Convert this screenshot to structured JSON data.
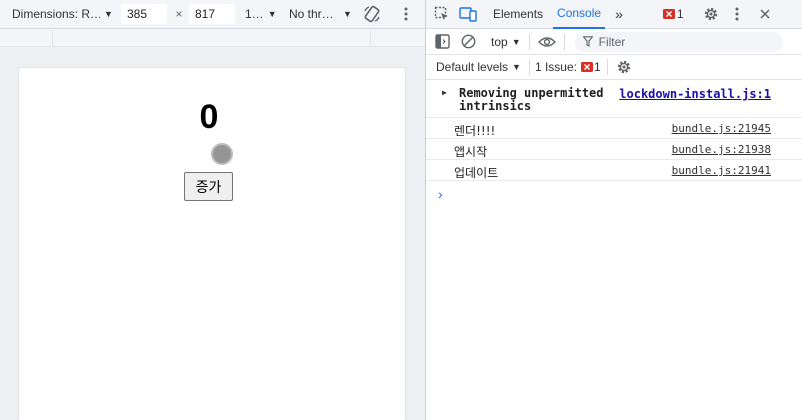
{
  "device_toolbar": {
    "dimensions_label": "Dimensions: R…",
    "width_value": "385",
    "times_symbol": "×",
    "height_value": "817",
    "zoom_label": "1…",
    "throttle_label": "No thr…",
    "rotate_icon": "rotate-icon",
    "more_icon": "more-vertical-icon"
  },
  "page": {
    "counter_value": "0",
    "increment_button_label": "증가"
  },
  "devtools": {
    "tabs": [
      {
        "label": "Elements",
        "active": false
      },
      {
        "label": "Console",
        "active": true
      }
    ],
    "more_tabs": "»",
    "issues_count": "1",
    "context_label": "top",
    "filter_placeholder": "Filter",
    "levels_label": "Default levels",
    "issue_label": "1 Issue:",
    "issue_count": "1"
  },
  "console": {
    "messages": [
      {
        "text_line1": "Removing unpermitted",
        "text_line2": "intrinsics",
        "source": "lockdown-install.js:1",
        "level": "warning"
      },
      {
        "text": "렌더!!!!",
        "source": "bundle.js:21945",
        "level": "log"
      },
      {
        "text": "앱시작",
        "source": "bundle.js:21938",
        "level": "log"
      },
      {
        "text": "업데이트",
        "source": "bundle.js:21941",
        "level": "log"
      }
    ],
    "prompt_symbol": "›"
  },
  "colors": {
    "accent": "#1a73e8",
    "error_badge": "#d93025",
    "toolbar_bg": "#f3f5f8",
    "button_bg": "#efefef"
  }
}
